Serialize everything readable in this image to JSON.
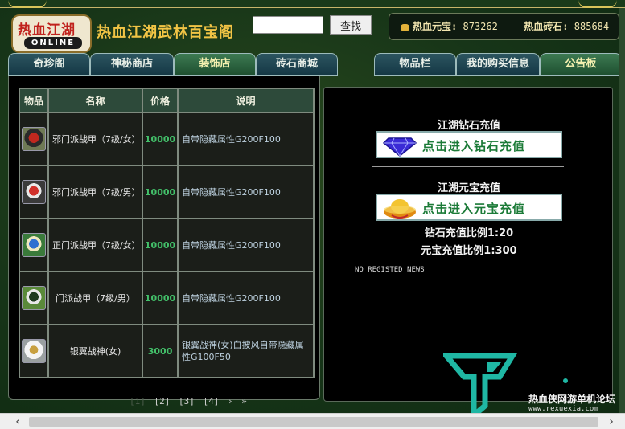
{
  "header": {
    "logo_text": "热血江湖",
    "logo_sub": "ONLINE",
    "site_title": "热血江湖武林百宝阁",
    "search_value": "",
    "search_button": "查找",
    "balance": {
      "yuanbao_label": "热血元宝:",
      "yuanbao_value": "873262",
      "zhuanshi_label": "热血砖石:",
      "zhuanshi_value": "885684"
    }
  },
  "tabs": [
    {
      "label": "奇珍阁",
      "active": false
    },
    {
      "label": "神秘商店",
      "active": false
    },
    {
      "label": "装饰店",
      "active": true
    },
    {
      "label": "砖石商城",
      "active": false
    },
    {
      "label": "物品栏",
      "active": false
    },
    {
      "label": "我的购买信息",
      "active": false
    },
    {
      "label": "公告板",
      "active": true
    }
  ],
  "table": {
    "headers": [
      "物品",
      "名称",
      "价格",
      "说明"
    ],
    "rows": [
      {
        "icon": "armor-red-icon",
        "name": "邪门派战甲（7级/女）",
        "price": "10000",
        "desc": "自带隐藏属性G200F100"
      },
      {
        "icon": "armor-red-icon",
        "name": "邪门派战甲（7级/男）",
        "price": "10000",
        "desc": "自带隐藏属性G200F100"
      },
      {
        "icon": "armor-blue-icon",
        "name": "正门派战甲（7级/女）",
        "price": "10000",
        "desc": "自带隐藏属性G200F100"
      },
      {
        "icon": "armor-green-icon",
        "name": "门派战甲（7级/男）",
        "price": "10000",
        "desc": "自带隐藏属性G200F100"
      },
      {
        "icon": "armor-white-icon",
        "name": "银翼战神(女)",
        "price": "3000",
        "desc": "银翼战神(女)白披风自带隐藏属性G100F50"
      }
    ]
  },
  "pager": {
    "pages": [
      "[1]",
      "[2]",
      "[3]",
      "[4]"
    ],
    "next": "›",
    "last": "»"
  },
  "notice": {
    "diamond_title": "江湖钻石充值",
    "diamond_button": "点击进入钻石充值",
    "yuanbao_title": "江湖元宝充值",
    "yuanbao_button": "点击进入元宝充值",
    "diamond_ratio": "钻石充值比例1:20",
    "yuanbao_ratio": "元宝充值比例1:300",
    "news": "NO REGISTED NEWS"
  },
  "watermark": {
    "text": "热血侠网游单机论坛",
    "url": "www.rexuexia.com"
  },
  "colors": {
    "accent_gold": "#f2c445",
    "price_green": "#43c16a",
    "panel_bg": "#000000"
  }
}
